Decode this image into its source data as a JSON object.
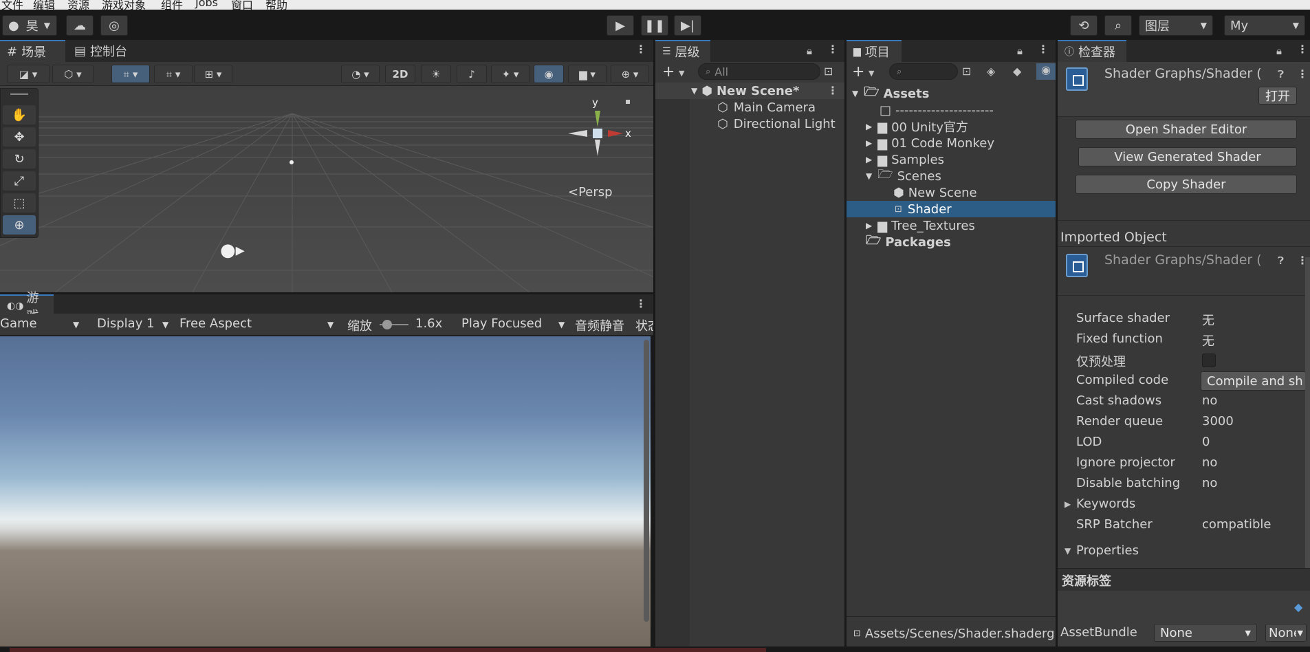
{
  "menubar": {
    "items": [
      "文件",
      "编辑",
      "资源",
      "游戏对象",
      "组件",
      "Jobs",
      "窗口",
      "帮助"
    ]
  },
  "toolbar": {
    "account_label": "昊",
    "layers_label": "图层",
    "layout_label": "My"
  },
  "scene": {
    "tab_scene": "场景",
    "tab_console": "控制台",
    "mode_2d": "2D",
    "gizmo_y": "y",
    "gizmo_x": "x",
    "persp_label": "<Persp"
  },
  "game": {
    "tab_label": "游戏",
    "view_dropdown": "Game",
    "display_dropdown": "Display 1",
    "aspect_dropdown": "Free Aspect",
    "scale_label": "缩放",
    "scale_value": "1.6x",
    "play_mode_dropdown": "Play Focused",
    "mute_label": "音频静音",
    "stats_label": "状态"
  },
  "hierarchy": {
    "tab_label": "层级",
    "search_placeholder": "All",
    "scene_name": "New Scene*",
    "items": [
      "Main Camera",
      "Directional Light"
    ]
  },
  "project": {
    "tab_label": "项目",
    "assets_label": "Assets",
    "separator": "----------------------",
    "folders": [
      "00 Unity官方",
      "01 Code Monkey",
      "Samples",
      "Scenes"
    ],
    "scenes_children": [
      "New Scene",
      "Shader"
    ],
    "after_folders": [
      "Tree_Textures"
    ],
    "packages_label": "Packages",
    "footer_path": "Assets/Scenes/Shader.shadergraph"
  },
  "inspector": {
    "tab_label": "检查器",
    "header_title": "Shader Graphs/Shader (Shader)",
    "open_button": "打开",
    "buttons": [
      "Open Shader Editor",
      "View Generated Shader",
      "Copy Shader"
    ],
    "imported_object_label": "Imported Object",
    "imported_title": "Shader Graphs/Shader (Shader)",
    "properties": [
      {
        "label": "Surface shader",
        "value": "无"
      },
      {
        "label": "Fixed function",
        "value": "无"
      },
      {
        "label": "仅预处理",
        "value": ""
      },
      {
        "label": "Compiled code",
        "value": "Compile and sh"
      },
      {
        "label": "Cast shadows",
        "value": "no"
      },
      {
        "label": "Render queue",
        "value": "3000"
      },
      {
        "label": "LOD",
        "value": "0"
      },
      {
        "label": "Ignore projector",
        "value": "no"
      },
      {
        "label": "Disable batching",
        "value": "no"
      },
      {
        "label": "Keywords",
        "value": ""
      },
      {
        "label": "SRP Batcher",
        "value": "compatible"
      },
      {
        "label": "Properties",
        "value": ""
      }
    ],
    "asset_labels_title": "资源标签",
    "assetbundle_label": "AssetBundle",
    "assetbundle_value": "None",
    "assetbundle_variant": "None"
  }
}
